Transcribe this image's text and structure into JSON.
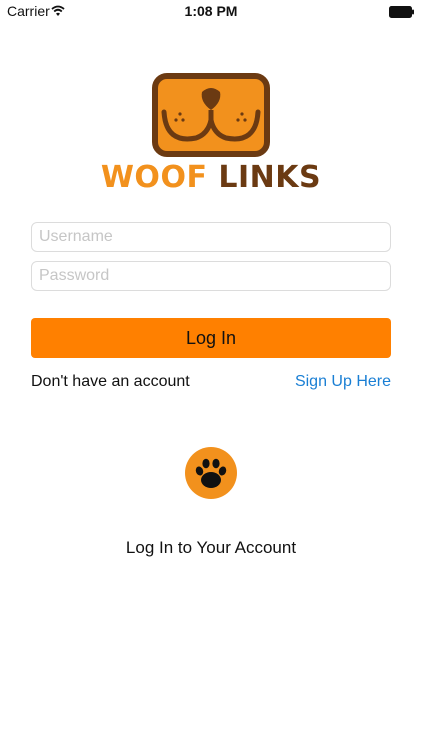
{
  "status_bar": {
    "carrier": "Carrier",
    "time": "1:08 PM",
    "wifi_icon": "wifi-icon",
    "battery_icon": "battery-icon"
  },
  "logo": {
    "icon": "dog-face-icon",
    "word1": "WOOF",
    "word2": "LINKS",
    "colors": {
      "orange": "#F2911D",
      "brown": "#6B3A12"
    }
  },
  "form": {
    "username_placeholder": "Username",
    "username_value": "",
    "password_placeholder": "Password",
    "password_value": "",
    "login_label": "Log In",
    "login_color": "#FF8000"
  },
  "signup": {
    "prompt": "Don't have an account",
    "link_label": "Sign Up Here",
    "link_color": "#1a7fd4"
  },
  "footer": {
    "paw_icon": "paw-icon",
    "caption": "Log In to Your Account"
  }
}
